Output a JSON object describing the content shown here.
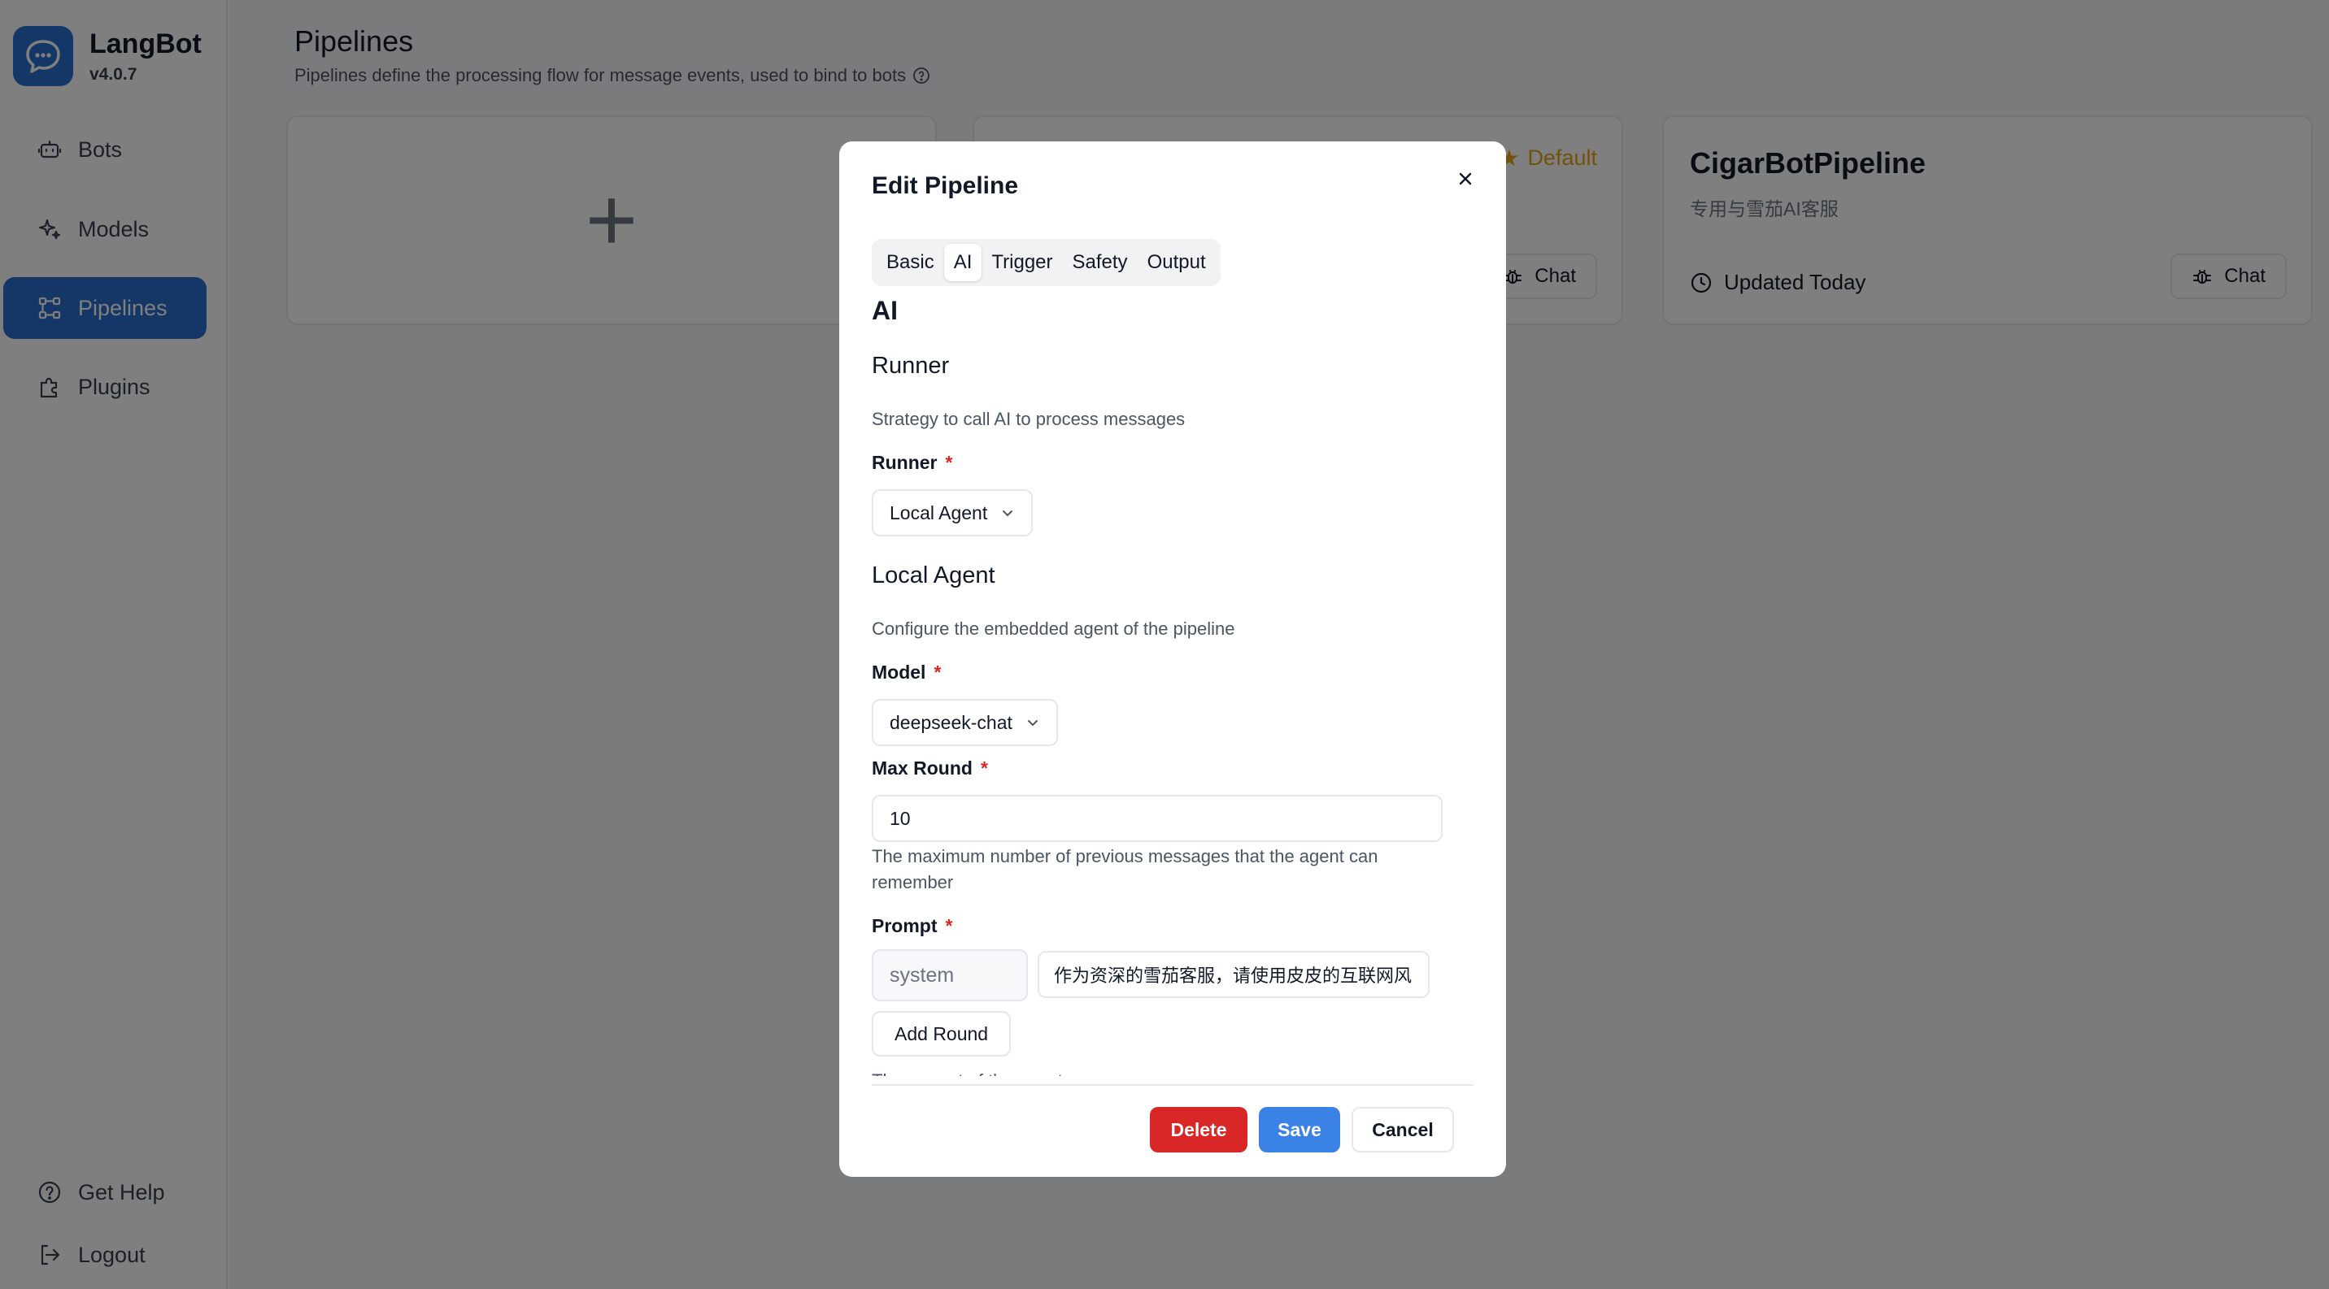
{
  "app": {
    "name": "LangBot",
    "version": "v4.0.7"
  },
  "sidebar": {
    "items": [
      {
        "label": "Bots",
        "icon": "bot-icon"
      },
      {
        "label": "Models",
        "icon": "sparkles-icon"
      },
      {
        "label": "Pipelines",
        "icon": "workflow-icon",
        "active": true
      },
      {
        "label": "Plugins",
        "icon": "puzzle-icon"
      }
    ],
    "bottom": [
      {
        "label": "Get Help",
        "icon": "help-circle-icon"
      },
      {
        "label": "Logout",
        "icon": "logout-icon"
      }
    ]
  },
  "page": {
    "title": "Pipelines",
    "subtitle": "Pipelines define the processing flow for message events, used to bind to bots"
  },
  "cards": [
    {
      "title": "",
      "description": "",
      "badge": "Default",
      "chat_label": "Chat"
    },
    {
      "title": "CigarBotPipeline",
      "description": "专用与雪茄AI客服",
      "updated": "Updated Today",
      "chat_label": "Chat"
    }
  ],
  "modal": {
    "title": "Edit Pipeline",
    "tabs": [
      "Basic",
      "AI",
      "Trigger",
      "Safety",
      "Output"
    ],
    "active_tab": "AI",
    "section_title": "AI",
    "runner_section": {
      "heading": "Runner",
      "description": "Strategy to call AI to process messages",
      "runner_label": "Runner",
      "runner_value": "Local Agent"
    },
    "local_agent_section": {
      "heading": "Local Agent",
      "description": "Configure the embedded agent of the pipeline",
      "model_label": "Model",
      "model_value": "deepseek-chat",
      "max_round_label": "Max Round",
      "max_round_value": "10",
      "max_round_help": "The maximum number of previous messages that the agent can remember",
      "prompt_label": "Prompt",
      "prompt_role": "system",
      "prompt_content": "作为资深的雪茄客服，请使用皮皮的互联网风",
      "add_round_label": "Add Round",
      "prompt_help": "The prompt of the agent"
    },
    "buttons": {
      "delete": "Delete",
      "save": "Save",
      "cancel": "Cancel"
    }
  },
  "colors": {
    "accent": "#2b6fd0",
    "save": "#3b82e6",
    "delete": "#d92626",
    "default_badge": "#e2a517",
    "required": "#dc2626"
  }
}
